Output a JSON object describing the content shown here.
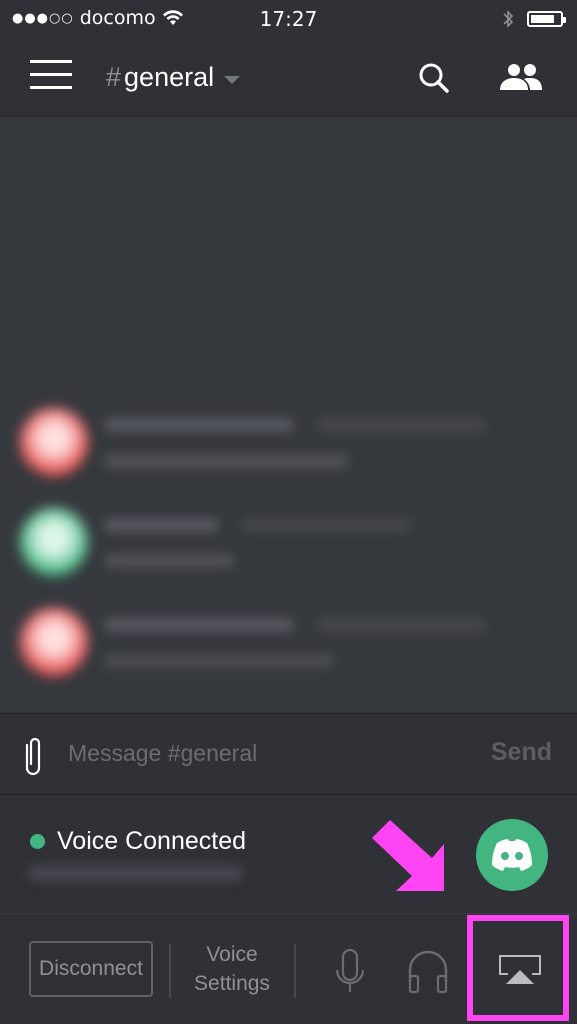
{
  "status_bar": {
    "signal": "●●●○○",
    "carrier": "docomo",
    "time": "17:27",
    "battery_level": 0.8
  },
  "header": {
    "channel_prefix": "#",
    "channel_name": "general",
    "icons": [
      "menu-icon",
      "search-icon",
      "members-icon"
    ]
  },
  "chat": {
    "messages_blurred": true,
    "messages": [
      {
        "avatar_color": "#e84d4d"
      },
      {
        "avatar_color": "#43b581"
      },
      {
        "avatar_color": "#e84d4d"
      }
    ]
  },
  "composer": {
    "placeholder": "Message #general",
    "send_label": "Send"
  },
  "voice": {
    "status": "Voice Connected",
    "status_color": "#43b581",
    "channel_blurred": true
  },
  "controls": {
    "disconnect_label": "Disconnect",
    "voice_settings_line1": "Voice",
    "voice_settings_line2": "Settings"
  },
  "annotation": {
    "highlight_color": "#ff44f4",
    "target": "airplay-button"
  }
}
